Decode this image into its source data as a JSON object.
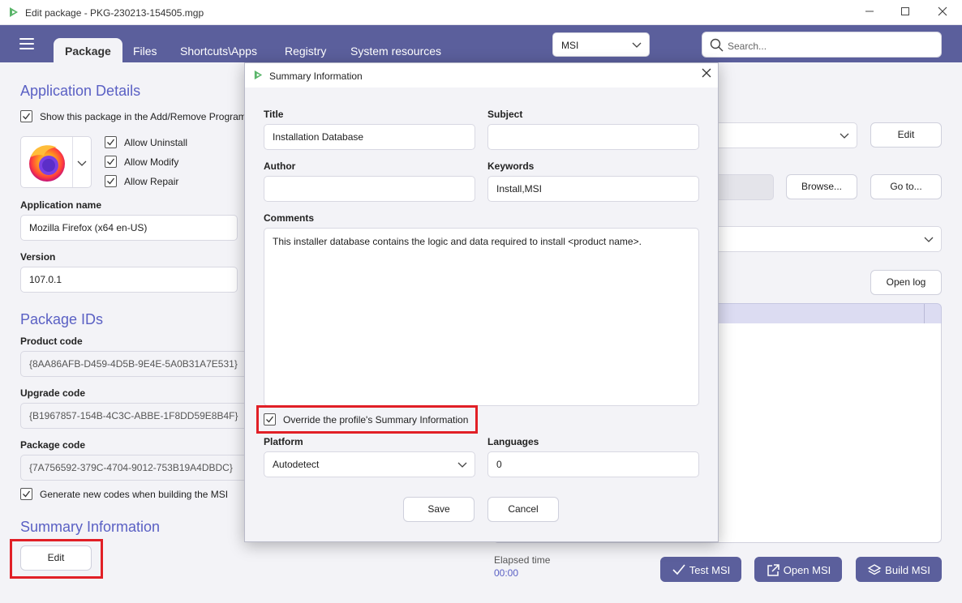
{
  "window": {
    "title": "Edit package - PKG-230213-154505.mgp"
  },
  "tabs": [
    "Package",
    "Files",
    "Shortcuts\\Apps",
    "Registry",
    "System resources"
  ],
  "header": {
    "msi_select": "MSI",
    "search_placeholder": "Search..."
  },
  "left": {
    "app_details_heading": "Application Details",
    "show_in_programs": "Show this package in the Add/Remove Programs",
    "allow_uninstall": "Allow Uninstall",
    "allow_modify": "Allow Modify",
    "allow_repair": "Allow Repair",
    "app_name_label": "Application name",
    "app_name_value": "Mozilla Firefox (x64 en-US)",
    "version_label": "Version",
    "version_value": "107.0.1",
    "package_ids_heading": "Package IDs",
    "product_code_label": "Product code",
    "product_code_value": "{8AA86AFB-D459-4D5B-9E4E-5A0B31A7E531}",
    "upgrade_code_label": "Upgrade code",
    "upgrade_code_value": "{B1967857-154B-4C3C-ABBE-1F8DD59E8B4F}",
    "package_code_label": "Package code",
    "package_code_value": "{7A756592-379C-4704-9012-753B19A4DBDC}",
    "generate_codes": "Generate new codes when building the MSI",
    "summary_heading": "Summary Information",
    "edit_button": "Edit"
  },
  "right": {
    "edit_button": "Edit",
    "browse_button": "Browse...",
    "goto_button": "Go to...",
    "open_log_button": "Open log",
    "elapsed_label": "Elapsed time",
    "elapsed_value": "00:00",
    "test_msi": "Test MSI",
    "open_msi": "Open MSI",
    "build_msi": "Build MSI"
  },
  "dialog": {
    "title": "Summary Information",
    "title_label": "Title",
    "title_value": "Installation Database",
    "subject_label": "Subject",
    "subject_value": "",
    "author_label": "Author",
    "author_value": "",
    "keywords_label": "Keywords",
    "keywords_value": "Install,MSI",
    "comments_label": "Comments",
    "comments_value": "This installer database contains the logic and data required to install <product name>.",
    "override_label": "Override the profile's Summary Information",
    "platform_label": "Platform",
    "platform_value": "Autodetect",
    "languages_label": "Languages",
    "languages_value": "0",
    "save_button": "Save",
    "cancel_button": "Cancel"
  },
  "colors": {
    "accent": "#5b5f9c",
    "heading": "#5a60c4",
    "highlight": "#e11f26"
  }
}
